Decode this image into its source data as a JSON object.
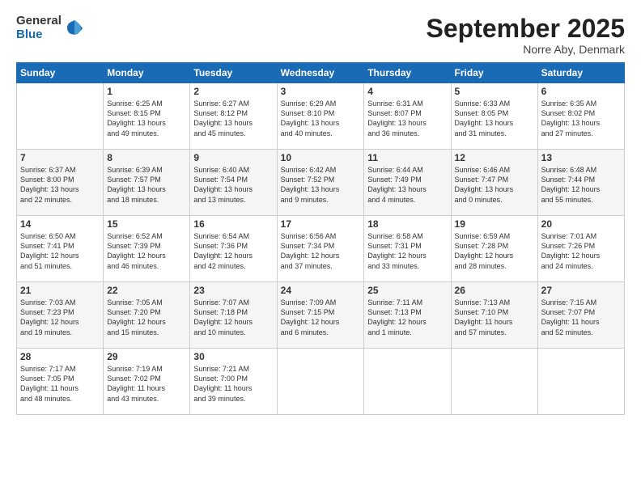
{
  "logo": {
    "general": "General",
    "blue": "Blue"
  },
  "header": {
    "month": "September 2025",
    "location": "Norre Aby, Denmark"
  },
  "weekdays": [
    "Sunday",
    "Monday",
    "Tuesday",
    "Wednesday",
    "Thursday",
    "Friday",
    "Saturday"
  ],
  "weeks": [
    [
      {
        "day": "",
        "info": ""
      },
      {
        "day": "1",
        "info": "Sunrise: 6:25 AM\nSunset: 8:15 PM\nDaylight: 13 hours\nand 49 minutes."
      },
      {
        "day": "2",
        "info": "Sunrise: 6:27 AM\nSunset: 8:12 PM\nDaylight: 13 hours\nand 45 minutes."
      },
      {
        "day": "3",
        "info": "Sunrise: 6:29 AM\nSunset: 8:10 PM\nDaylight: 13 hours\nand 40 minutes."
      },
      {
        "day": "4",
        "info": "Sunrise: 6:31 AM\nSunset: 8:07 PM\nDaylight: 13 hours\nand 36 minutes."
      },
      {
        "day": "5",
        "info": "Sunrise: 6:33 AM\nSunset: 8:05 PM\nDaylight: 13 hours\nand 31 minutes."
      },
      {
        "day": "6",
        "info": "Sunrise: 6:35 AM\nSunset: 8:02 PM\nDaylight: 13 hours\nand 27 minutes."
      }
    ],
    [
      {
        "day": "7",
        "info": "Sunrise: 6:37 AM\nSunset: 8:00 PM\nDaylight: 13 hours\nand 22 minutes."
      },
      {
        "day": "8",
        "info": "Sunrise: 6:39 AM\nSunset: 7:57 PM\nDaylight: 13 hours\nand 18 minutes."
      },
      {
        "day": "9",
        "info": "Sunrise: 6:40 AM\nSunset: 7:54 PM\nDaylight: 13 hours\nand 13 minutes."
      },
      {
        "day": "10",
        "info": "Sunrise: 6:42 AM\nSunset: 7:52 PM\nDaylight: 13 hours\nand 9 minutes."
      },
      {
        "day": "11",
        "info": "Sunrise: 6:44 AM\nSunset: 7:49 PM\nDaylight: 13 hours\nand 4 minutes."
      },
      {
        "day": "12",
        "info": "Sunrise: 6:46 AM\nSunset: 7:47 PM\nDaylight: 13 hours\nand 0 minutes."
      },
      {
        "day": "13",
        "info": "Sunrise: 6:48 AM\nSunset: 7:44 PM\nDaylight: 12 hours\nand 55 minutes."
      }
    ],
    [
      {
        "day": "14",
        "info": "Sunrise: 6:50 AM\nSunset: 7:41 PM\nDaylight: 12 hours\nand 51 minutes."
      },
      {
        "day": "15",
        "info": "Sunrise: 6:52 AM\nSunset: 7:39 PM\nDaylight: 12 hours\nand 46 minutes."
      },
      {
        "day": "16",
        "info": "Sunrise: 6:54 AM\nSunset: 7:36 PM\nDaylight: 12 hours\nand 42 minutes."
      },
      {
        "day": "17",
        "info": "Sunrise: 6:56 AM\nSunset: 7:34 PM\nDaylight: 12 hours\nand 37 minutes."
      },
      {
        "day": "18",
        "info": "Sunrise: 6:58 AM\nSunset: 7:31 PM\nDaylight: 12 hours\nand 33 minutes."
      },
      {
        "day": "19",
        "info": "Sunrise: 6:59 AM\nSunset: 7:28 PM\nDaylight: 12 hours\nand 28 minutes."
      },
      {
        "day": "20",
        "info": "Sunrise: 7:01 AM\nSunset: 7:26 PM\nDaylight: 12 hours\nand 24 minutes."
      }
    ],
    [
      {
        "day": "21",
        "info": "Sunrise: 7:03 AM\nSunset: 7:23 PM\nDaylight: 12 hours\nand 19 minutes."
      },
      {
        "day": "22",
        "info": "Sunrise: 7:05 AM\nSunset: 7:20 PM\nDaylight: 12 hours\nand 15 minutes."
      },
      {
        "day": "23",
        "info": "Sunrise: 7:07 AM\nSunset: 7:18 PM\nDaylight: 12 hours\nand 10 minutes."
      },
      {
        "day": "24",
        "info": "Sunrise: 7:09 AM\nSunset: 7:15 PM\nDaylight: 12 hours\nand 6 minutes."
      },
      {
        "day": "25",
        "info": "Sunrise: 7:11 AM\nSunset: 7:13 PM\nDaylight: 12 hours\nand 1 minute."
      },
      {
        "day": "26",
        "info": "Sunrise: 7:13 AM\nSunset: 7:10 PM\nDaylight: 11 hours\nand 57 minutes."
      },
      {
        "day": "27",
        "info": "Sunrise: 7:15 AM\nSunset: 7:07 PM\nDaylight: 11 hours\nand 52 minutes."
      }
    ],
    [
      {
        "day": "28",
        "info": "Sunrise: 7:17 AM\nSunset: 7:05 PM\nDaylight: 11 hours\nand 48 minutes."
      },
      {
        "day": "29",
        "info": "Sunrise: 7:19 AM\nSunset: 7:02 PM\nDaylight: 11 hours\nand 43 minutes."
      },
      {
        "day": "30",
        "info": "Sunrise: 7:21 AM\nSunset: 7:00 PM\nDaylight: 11 hours\nand 39 minutes."
      },
      {
        "day": "",
        "info": ""
      },
      {
        "day": "",
        "info": ""
      },
      {
        "day": "",
        "info": ""
      },
      {
        "day": "",
        "info": ""
      }
    ]
  ]
}
